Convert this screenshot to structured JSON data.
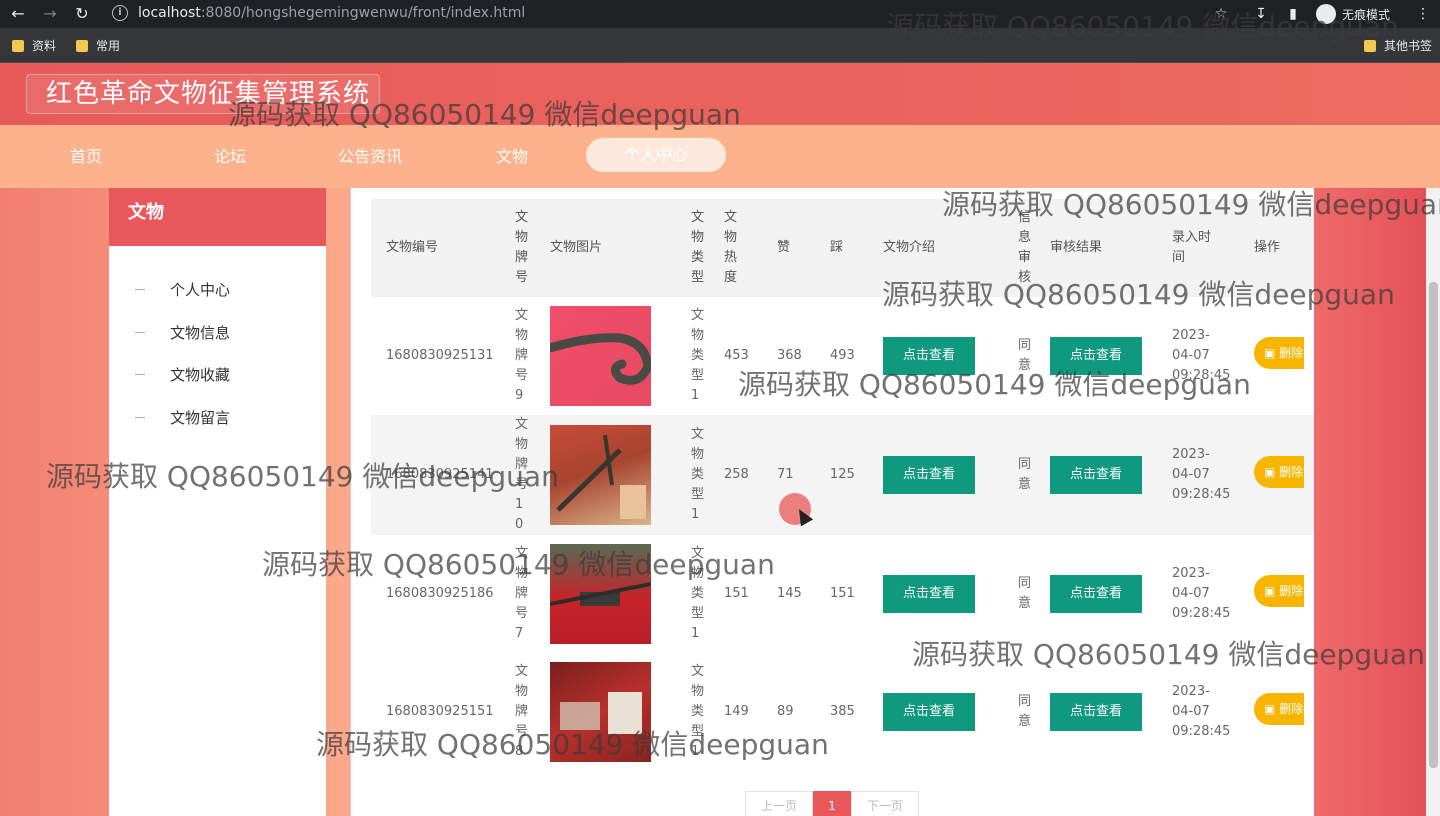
{
  "browser": {
    "url_host": "localhost",
    "url_path": ":8080/hongshegemingwenwu/front/index.html",
    "incognito_label": "无痕模式",
    "bookmarks": [
      "资料",
      "常用"
    ],
    "other_bookmarks": "其他书签",
    "icons": [
      "back-icon",
      "forward-icon",
      "reload-icon",
      "info-icon",
      "star-icon",
      "download-icon",
      "sidebar-icon",
      "more-icon"
    ]
  },
  "site": {
    "title": "红色革命文物征集管理系统"
  },
  "nav": {
    "items": [
      "首页",
      "论坛",
      "公告资讯",
      "文物"
    ],
    "active": "个人中心"
  },
  "sidebar": {
    "title": "文物",
    "items": [
      "个人中心",
      "文物信息",
      "文物收藏",
      "文物留言"
    ]
  },
  "table": {
    "headers": [
      "文物编号",
      "文物牌号",
      "文物图片",
      "文物类型",
      "文物热度",
      "赞",
      "踩",
      "文物介绍",
      "信息审核",
      "审核结果",
      "录入时间",
      "操作"
    ],
    "view_label": "点击查看",
    "delete_label": "删除",
    "rows": [
      {
        "id": "1680830925131",
        "plate": "文物牌号9",
        "type": "文物类型1",
        "heat": "453",
        "zan": "368",
        "cai": "493",
        "status": "同意",
        "time": "2023-04-07 09:28:45"
      },
      {
        "id": "1680830925141",
        "plate": "文物牌号10",
        "type": "文物类型1",
        "heat": "258",
        "zan": "71",
        "cai": "125",
        "status": "同意",
        "time": "2023-04-07 09:28:45"
      },
      {
        "id": "1680830925186",
        "plate": "文物牌号7",
        "type": "文物类型1",
        "heat": "151",
        "zan": "145",
        "cai": "151",
        "status": "同意",
        "time": "2023-04-07 09:28:45"
      },
      {
        "id": "1680830925151",
        "plate": "文物牌号8",
        "type": "文物类型1",
        "heat": "149",
        "zan": "89",
        "cai": "385",
        "status": "同意",
        "time": "2023-04-07 09:28:45"
      }
    ]
  },
  "pager": {
    "prev": "上一页",
    "current": "1",
    "next": "下一页"
  },
  "watermark": "源码获取 QQ86050149 微信deepguan"
}
